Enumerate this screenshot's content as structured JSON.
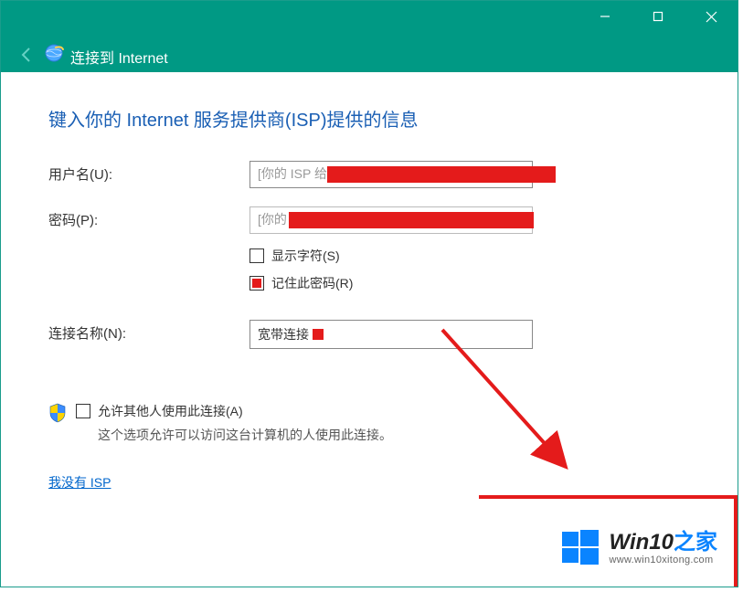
{
  "titlebar": {
    "title": "连接到 Internet"
  },
  "content": {
    "heading": "键入你的 Internet 服务提供商(ISP)提供的信息",
    "username_label": "用户名(U):",
    "username_placeholder": "[你的 ISP 给你的名称]",
    "password_label": "密码(P):",
    "password_placeholder": "[你的 ISP 给你的密码]",
    "checkbox_show_chars": "显示字符(S)",
    "checkbox_remember": "记住此密码(R)",
    "connection_name_label": "连接名称(N):",
    "connection_name_value": "宽带连接",
    "allow_others_label": "允许其他人使用此连接(A)",
    "allow_others_desc": "这个选项允许可以访问这台计算机的人使用此连接。",
    "no_isp_link": "我没有 ISP"
  },
  "watermark": {
    "brand_main": "Win10",
    "brand_suffix": "之家",
    "url": "www.win10xitong.com"
  }
}
